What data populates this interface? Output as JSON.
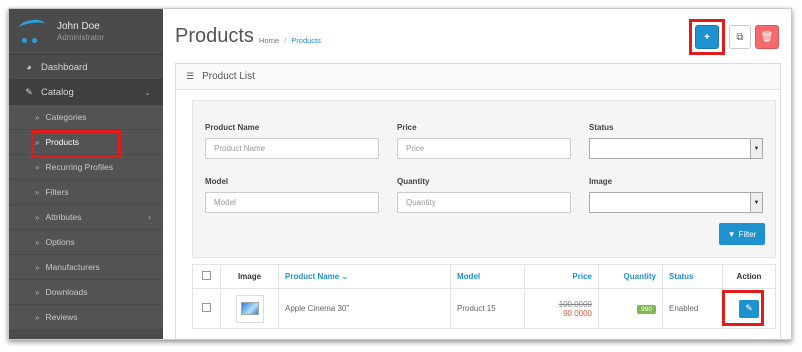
{
  "profile": {
    "name": "John Doe",
    "role": "Administrator"
  },
  "sidebar": {
    "items": [
      {
        "label": "Dashboard",
        "icon": "dashboard-icon"
      },
      {
        "label": "Catalog",
        "icon": "tag-icon"
      }
    ],
    "catalog_children": [
      {
        "label": "Categories"
      },
      {
        "label": "Products"
      },
      {
        "label": "Recurring Profiles"
      },
      {
        "label": "Filters"
      },
      {
        "label": "Attributes"
      },
      {
        "label": "Options"
      },
      {
        "label": "Manufacturers"
      },
      {
        "label": "Downloads"
      },
      {
        "label": "Reviews"
      }
    ]
  },
  "header": {
    "title": "Products",
    "breadcrumb": [
      "Home",
      "Products"
    ],
    "buttons": {
      "add": "+",
      "copy": "copy-icon",
      "delete": "trash-icon"
    }
  },
  "panel": {
    "title": "Product List"
  },
  "filter": {
    "product_name": {
      "label": "Product Name",
      "placeholder": "Product Name"
    },
    "price": {
      "label": "Price",
      "placeholder": "Price"
    },
    "status": {
      "label": "Status",
      "value": ""
    },
    "model": {
      "label": "Model",
      "placeholder": "Model"
    },
    "quantity": {
      "label": "Quantity",
      "placeholder": "Quantity"
    },
    "image": {
      "label": "Image",
      "value": ""
    },
    "button": "Filter"
  },
  "table": {
    "columns": [
      "Image",
      "Product Name",
      "Model",
      "Price",
      "Quantity",
      "Status",
      "Action"
    ],
    "sort_indicator": "⌄",
    "rows": [
      {
        "name": "Apple Cinema 30\"",
        "model": "Product 15",
        "price_old": "100.0000",
        "price_new": "90.0000",
        "quantity": "990",
        "status": "Enabled"
      }
    ]
  },
  "colors": {
    "accent": "#1e91cf",
    "danger": "#f56b6b",
    "highlight": "#e11a1a",
    "sidebar": "#4b4b4b"
  }
}
